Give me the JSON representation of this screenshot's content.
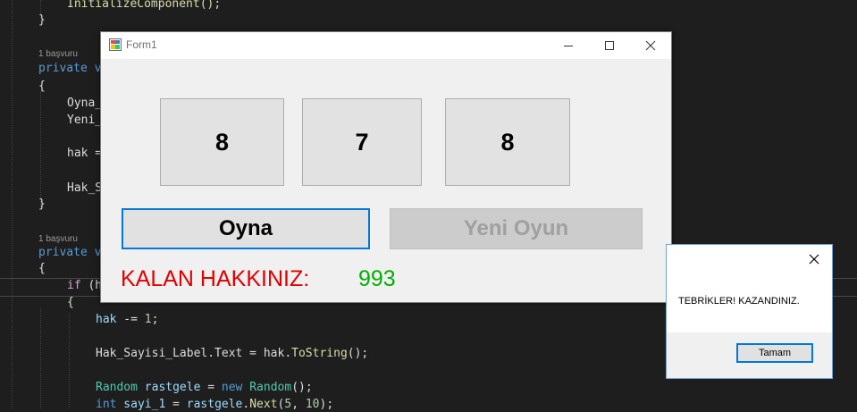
{
  "editor": {
    "references": [
      "1 başvuru",
      "1 başvuru"
    ],
    "lines": {
      "init_call": "InitializeComponent();",
      "brace_close_1": "}",
      "private_1": "private v",
      "brace_open_1": "{",
      "oyna_frag": "Oyna_",
      "yeni_frag": "Yeni_",
      "hak_frag": "hak =",
      "hak_s_frag": "Hak_S",
      "brace_close_2": "}",
      "private_2": "private v",
      "brace_open_2": "{",
      "if_kw": "if",
      "if_rest": " (h",
      "brace_open_3": "{",
      "hak_minus_var": "hak",
      "hak_minus_op": " -= ",
      "hak_minus_num": "1",
      "hak_minus_end": ";",
      "label_text_line": "Hak_Sayisi_Label.Text = hak.",
      "label_text_meth": "ToString",
      "label_text_end": "();",
      "random_type": "Random",
      "random_var": " rastgele",
      "random_eq": " = ",
      "random_new": "new",
      "random_type2": " Random",
      "random_end": "();",
      "int_kw": "int",
      "int_var": " sayi_1",
      "int_eq": " = ",
      "int_obj": "rastgele",
      "int_dot": ".",
      "int_meth": "Next",
      "int_open": "(",
      "int_n1": "5",
      "int_comma": ", ",
      "int_n2": "10",
      "int_end": ");"
    }
  },
  "form": {
    "title": "Form1",
    "slots": [
      "8",
      "7",
      "8"
    ],
    "play_button": "Oyna",
    "new_game_button": "Yeni Oyun",
    "remaining_label": "KALAN HAKKINIZ:",
    "remaining_value": "993"
  },
  "message_box": {
    "text": "TEBRİKLER! KAZANDINIZ.",
    "ok_button": "Tamam"
  },
  "colors": {
    "editor_bg": "#1e1e1e",
    "accent": "#0078d7",
    "remaining_label": "#e00000",
    "remaining_value": "#00b000"
  }
}
